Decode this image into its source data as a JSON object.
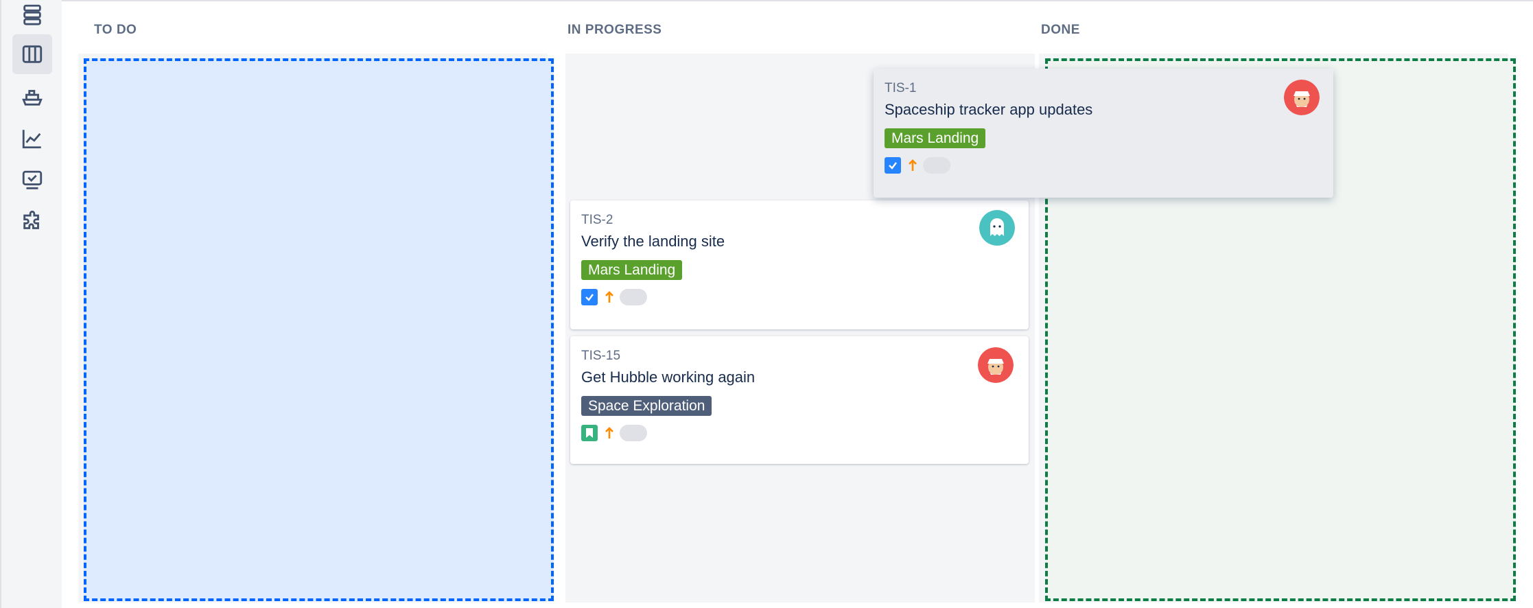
{
  "sidebar": {
    "items": [
      {
        "icon": "layers-icon",
        "active": false
      },
      {
        "icon": "board-columns-icon",
        "active": true
      },
      {
        "icon": "ship-icon",
        "active": false
      },
      {
        "icon": "reports-chart-icon",
        "active": false
      },
      {
        "icon": "monitor-check-icon",
        "active": false
      },
      {
        "icon": "puzzle-icon",
        "active": false
      }
    ]
  },
  "board": {
    "columns": [
      {
        "title": "TO DO"
      },
      {
        "title": "IN PROGRESS"
      },
      {
        "title": "DONE"
      }
    ],
    "cards": [
      {
        "key": "TIS-1",
        "title": "Spaceship tracker app updates",
        "epic": "Mars Landing",
        "type": "task",
        "priority": "medium",
        "avatar": "santa-avatar",
        "state": "dragging"
      },
      {
        "key": "TIS-2",
        "title": "Verify the landing site",
        "epic": "Mars Landing",
        "type": "task",
        "priority": "medium",
        "avatar": "ghost-avatar"
      },
      {
        "key": "TIS-15",
        "title": "Get Hubble working again",
        "epic": "Space Exploration",
        "type": "story",
        "priority": "medium",
        "avatar": "santa-avatar"
      }
    ]
  },
  "colors": {
    "todo_drop_border": "#0065ff",
    "done_drop_border": "#0b7d45",
    "epic_mars": "#5aa02c",
    "epic_space": "#505f79",
    "priority": "#ff8b00"
  }
}
